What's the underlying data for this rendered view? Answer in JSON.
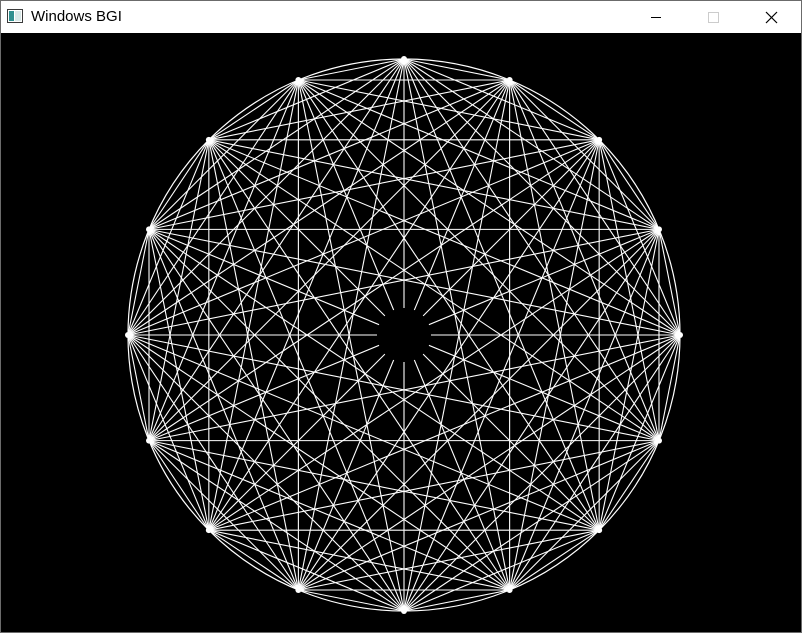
{
  "window": {
    "title": "Windows BGI",
    "controls": {
      "minimize_icon": "minimize-icon",
      "maximize_icon": "maximize-icon",
      "maximize_enabled": false,
      "close_icon": "close-icon"
    }
  },
  "canvas": {
    "background": "#000000",
    "line_color": "#ffffff",
    "figure": "circle-with-16-points-connected-by-chords",
    "points_on_circle": 16,
    "skip_steps": [
      1,
      2,
      3,
      4,
      5,
      6,
      7
    ],
    "center_hole": true
  }
}
